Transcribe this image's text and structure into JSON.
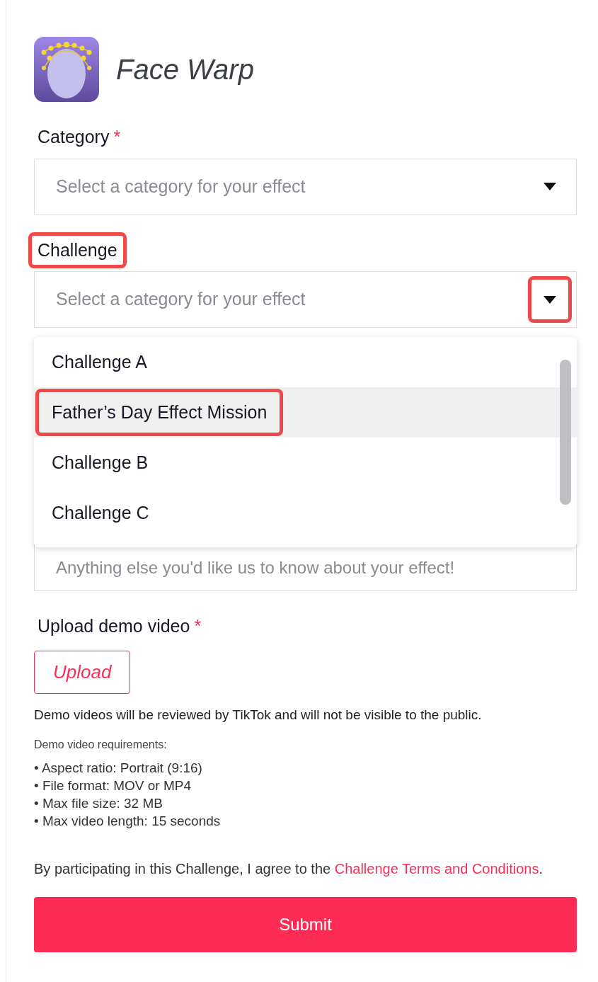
{
  "app": {
    "name": "Face Warp"
  },
  "fields": [
    {
      "kind": "select",
      "label": "Category",
      "required_mark": "*",
      "placeholder": "Select a category for your effect",
      "label_highlighted": false,
      "arrow_highlighted": false
    },
    {
      "kind": "select",
      "label": "Challenge",
      "placeholder": "Select a category for your effect",
      "label_highlighted": true,
      "arrow_highlighted": true,
      "options": [
        {
          "label": "Challenge A",
          "selected": false,
          "highlighted": false
        },
        {
          "label": "Father’s Day Effect Mission",
          "selected": true,
          "highlighted": true
        },
        {
          "label": "Challenge B",
          "selected": false,
          "highlighted": false
        },
        {
          "label": "Challenge C",
          "selected": false,
          "highlighted": false
        }
      ]
    },
    {
      "kind": "textarea",
      "placeholder": "Anything else you'd like us to know about your effect!"
    }
  ],
  "upload": {
    "label": "Upload demo video",
    "required_mark": "*",
    "button": "Upload",
    "note": "Demo videos will be reviewed by TikTok and will not be visible to the public.",
    "requirements_title": "Demo video requirements:",
    "requirements": [
      "• Aspect ratio: Portrait (9:16)",
      "• File format: MOV or MP4",
      "• Max file size: 32 MB",
      "• Max video length: 15 seconds"
    ]
  },
  "agreement": {
    "text": "By participating in this Challenge, I agree to the ",
    "link": "Challenge Terms and Conditions",
    "end": "."
  },
  "submit": "Submit"
}
